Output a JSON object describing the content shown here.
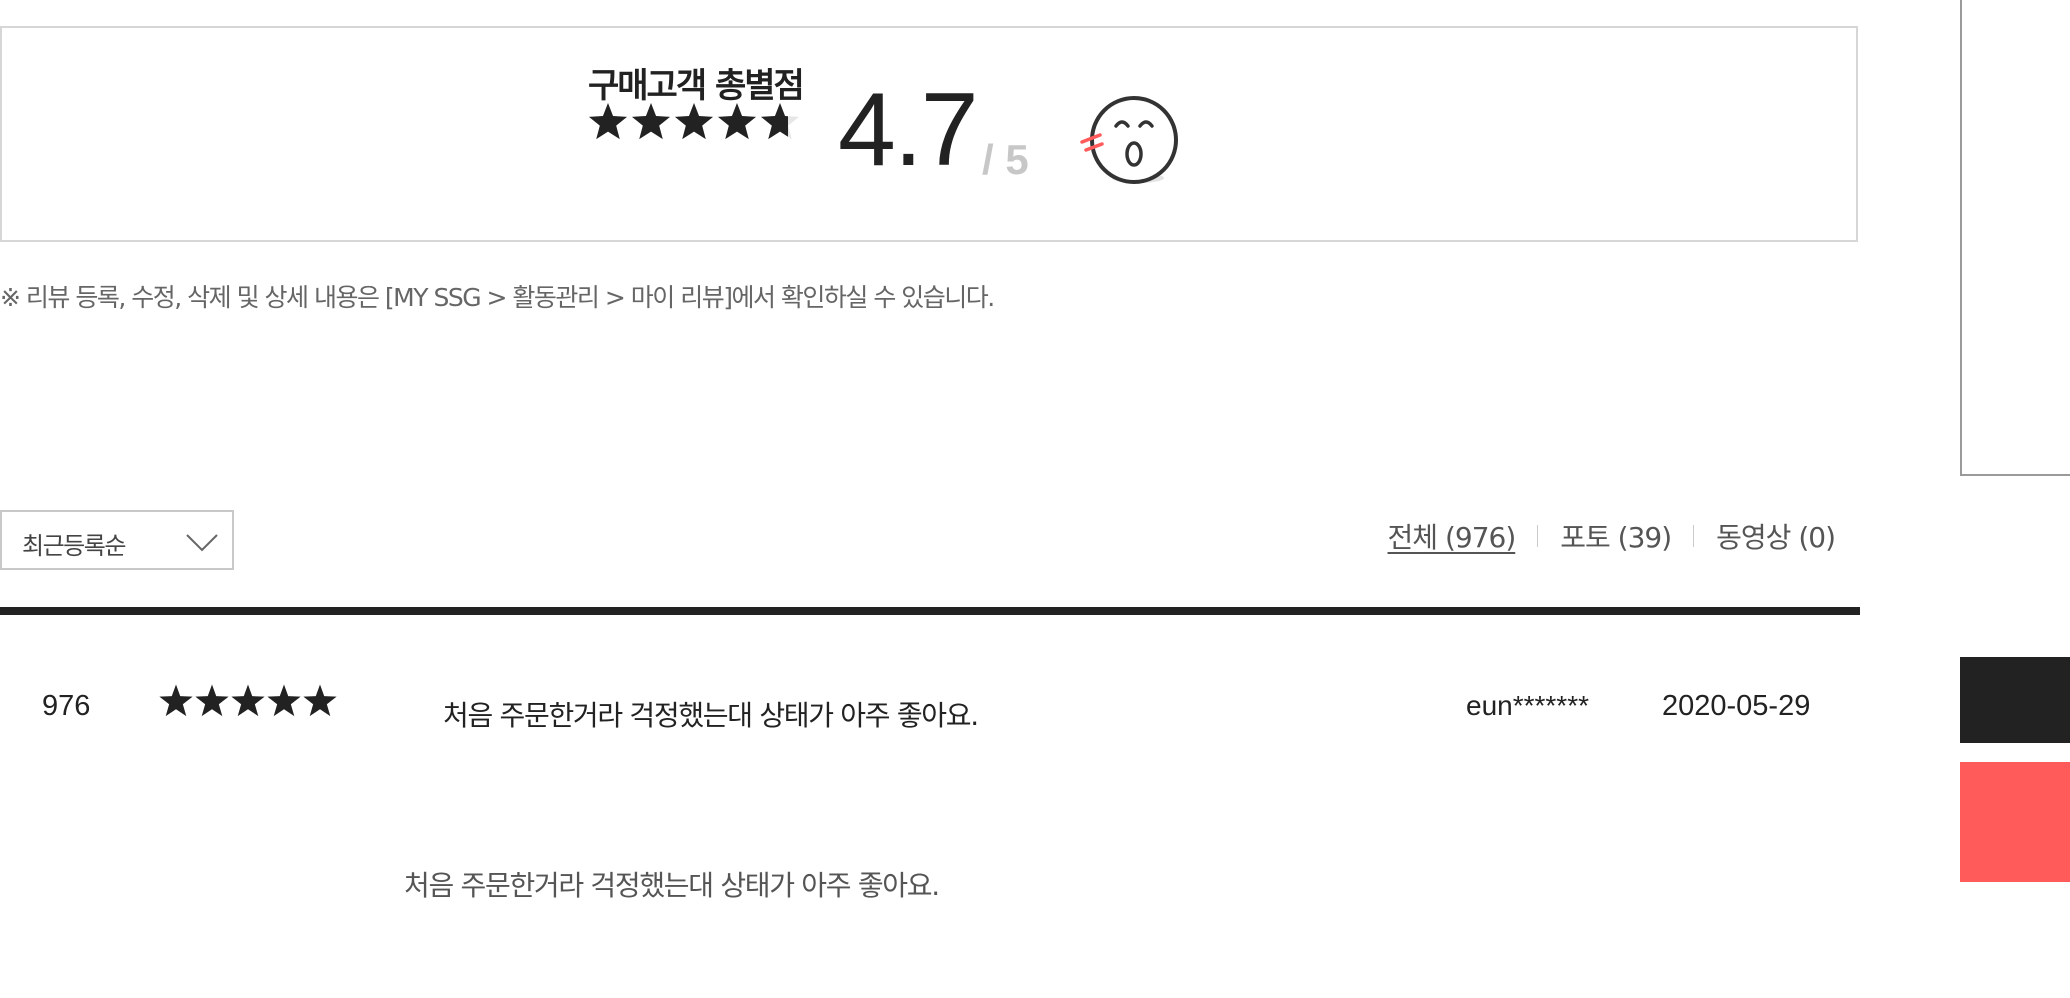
{
  "summary": {
    "title": "구매고객 총별점",
    "score": "4.7",
    "max": "/ 5",
    "rating_value": 4.7,
    "rating_max": 5,
    "face_icon": "surprised-face-icon"
  },
  "notice": "※ 리뷰 등록, 수정, 삭제 및 상세 내용은 [MY SSG > 활동관리 > 마이 리뷰]에서 확인하실 수 있습니다.",
  "sort": {
    "selected": "최근등록순",
    "icon": "chevron-down-icon"
  },
  "filters": [
    {
      "label": "전체 (976)",
      "active": true
    },
    {
      "label": "포토 (39)",
      "active": false
    },
    {
      "label": "동영상 (0)",
      "active": false
    }
  ],
  "reviews": [
    {
      "number": "976",
      "stars_label": "★★★★★",
      "rating": 5,
      "title": "처음 주문한거라 걱정했는대 상태가 아주 좋아요.",
      "user": "eun*******",
      "date": "2020-05-29",
      "body": "처음 주문한거라 걱정했는대 상태가 아주 좋아요."
    }
  ],
  "colors": {
    "text": "#222222",
    "muted": "#666666",
    "border": "#d6d6d6",
    "accent_red": "#ff5b5b",
    "dark": "#222222",
    "score_max": "#c7c7c7"
  }
}
